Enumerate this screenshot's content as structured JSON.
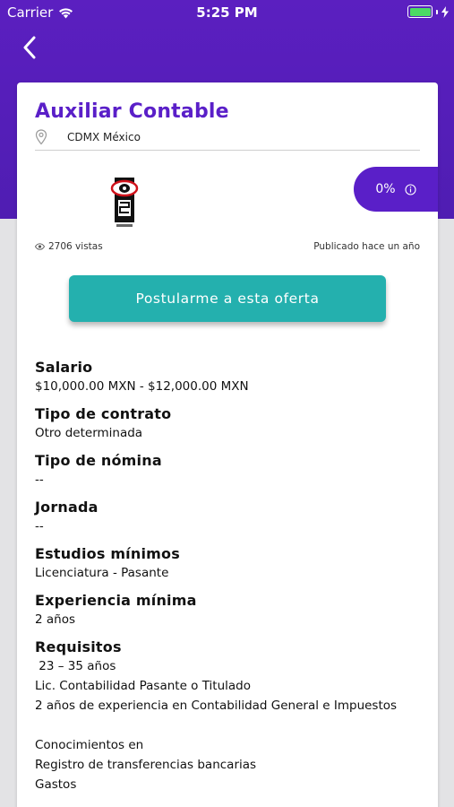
{
  "status_bar": {
    "carrier": "Carrier",
    "time": "5:25 PM"
  },
  "job": {
    "title": "Auxiliar Contable",
    "location": "CDMX México",
    "match_percent": "0%",
    "views": "2706 vistas",
    "published": "Publicado hace un año",
    "apply_label": "Postularme a esta oferta"
  },
  "details": {
    "salary": {
      "label": "Salario",
      "value": "$10,000.00 MXN - $12,000.00 MXN"
    },
    "contract": {
      "label": "Tipo de contrato",
      "value": "Otro determinada"
    },
    "payroll": {
      "label": "Tipo de nómina",
      "value": "--"
    },
    "schedule": {
      "label": "Jornada",
      "value": "--"
    },
    "education": {
      "label": "Estudios mínimos",
      "value": "Licenciatura - Pasante"
    },
    "experience": {
      "label": "Experiencia mínima",
      "value": "2 años"
    },
    "requirements": {
      "label": "Requisitos",
      "lines": [
        " 23 – 35 años",
        "Lic. Contabilidad Pasante o Titulado",
        "2 años de experiencia en Contabilidad General e Impuestos",
        "",
        "Conocimientos en",
        "Registro de transferencias bancarias",
        "Gastos"
      ]
    }
  },
  "colors": {
    "header": "#5b1fc0",
    "title": "#5a1fc8",
    "accent_button": "#24b0ae",
    "battery": "#4cd964"
  }
}
